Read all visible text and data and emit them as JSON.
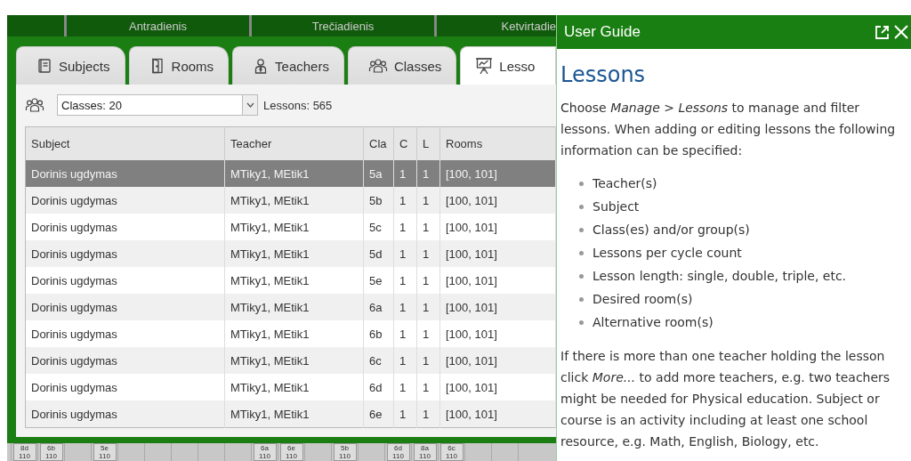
{
  "days": [
    "Antradienis",
    "Trečiadienis",
    "Ketvirtadie"
  ],
  "tabs": [
    {
      "label": "Subjects",
      "selected": false
    },
    {
      "label": "Rooms",
      "selected": false
    },
    {
      "label": "Teachers",
      "selected": false
    },
    {
      "label": "Classes",
      "selected": false
    },
    {
      "label": "Lesso",
      "selected": true
    }
  ],
  "filter": {
    "value": "Classes: 20",
    "count": "Lessons: 565"
  },
  "table": {
    "columns": [
      "Subject",
      "Teacher",
      "Cla",
      "C",
      "L",
      "Rooms"
    ],
    "rows": [
      {
        "cells": [
          "Dorinis ugdymas",
          "MTiky1, MEtik1",
          "5a",
          "1",
          "1",
          "[100, 101]"
        ],
        "selected": true
      },
      {
        "cells": [
          "Dorinis ugdymas",
          "MTiky1, MEtik1",
          "5b",
          "1",
          "1",
          "[100, 101]"
        ],
        "selected": false
      },
      {
        "cells": [
          "Dorinis ugdymas",
          "MTiky1, MEtik1",
          "5c",
          "1",
          "1",
          "[100, 101]"
        ],
        "selected": false
      },
      {
        "cells": [
          "Dorinis ugdymas",
          "MTiky1, MEtik1",
          "5d",
          "1",
          "1",
          "[100, 101]"
        ],
        "selected": false
      },
      {
        "cells": [
          "Dorinis ugdymas",
          "MTiky1, MEtik1",
          "5e",
          "1",
          "1",
          "[100, 101]"
        ],
        "selected": false
      },
      {
        "cells": [
          "Dorinis ugdymas",
          "MTiky1, MEtik1",
          "6a",
          "1",
          "1",
          "[100, 101]"
        ],
        "selected": false
      },
      {
        "cells": [
          "Dorinis ugdymas",
          "MTiky1, MEtik1",
          "6b",
          "1",
          "1",
          "[100, 101]"
        ],
        "selected": false
      },
      {
        "cells": [
          "Dorinis ugdymas",
          "MTiky1, MEtik1",
          "6c",
          "1",
          "1",
          "[100, 101]"
        ],
        "selected": false
      },
      {
        "cells": [
          "Dorinis ugdymas",
          "MTiky1, MEtik1",
          "6d",
          "1",
          "1",
          "[100, 101]"
        ],
        "selected": false
      },
      {
        "cells": [
          "Dorinis ugdymas",
          "MTiky1, MEtik1",
          "6e",
          "1",
          "1",
          "[100, 101]"
        ],
        "selected": false
      }
    ]
  },
  "timetable_strip": [
    {
      "kind": "chip",
      "class": "8d",
      "room": "110"
    },
    {
      "kind": "chip",
      "class": "6b",
      "room": "110"
    },
    {
      "kind": "empty"
    },
    {
      "kind": "chip",
      "class": "5e",
      "room": "110"
    },
    {
      "kind": "empty"
    },
    {
      "kind": "empty"
    },
    {
      "kind": "empty"
    },
    {
      "kind": "empty"
    },
    {
      "kind": "empty"
    },
    {
      "kind": "chip",
      "class": "6a",
      "room": "110"
    },
    {
      "kind": "chip",
      "class": "6e",
      "room": "110"
    },
    {
      "kind": "empty"
    },
    {
      "kind": "chip",
      "class": "5b",
      "room": "110"
    },
    {
      "kind": "empty"
    },
    {
      "kind": "chip",
      "class": "6d",
      "room": "110"
    },
    {
      "kind": "chip",
      "class": "8a",
      "room": "110"
    },
    {
      "kind": "chip",
      "class": "6c",
      "room": "110"
    },
    {
      "kind": "empty"
    },
    {
      "kind": "empty"
    },
    {
      "kind": "empty"
    }
  ],
  "guide": {
    "title": "User Guide",
    "heading": "Lessons",
    "intro": "Choose *Manage > Lessons* to manage and filter lessons. When adding or editing lessons the following information can be specified:",
    "items": [
      "Teacher(s)",
      "Subject",
      "Class(es) and/or group(s)",
      "Lessons per cycle count",
      "Lesson length: single, double, triple, etc.",
      "Desired room(s)",
      "Alternative room(s)"
    ],
    "body": "If there is more than one teacher holding the lesson click *More...* to add more teachers, e.g. two teachers might be needed for Physical education. Subject or course is an activity including at least one school resource, e.g. Math, English, Biology, etc."
  }
}
